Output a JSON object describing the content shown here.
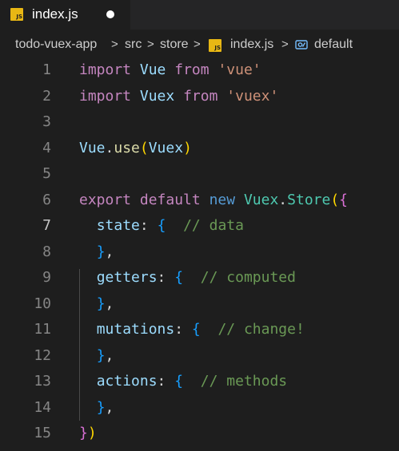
{
  "tab": {
    "label": "index.js",
    "icon": "js-file-icon",
    "badge_text": "JS",
    "dirty": true
  },
  "breadcrumb": {
    "items": [
      "todo-vuex-app",
      "src",
      "store",
      "index.js",
      "default"
    ],
    "separator": ">"
  },
  "editor": {
    "active_line": 7,
    "line_numbers": [
      "1",
      "2",
      "3",
      "4",
      "5",
      "6",
      "7",
      "8",
      "9",
      "10",
      "11",
      "12",
      "13",
      "14",
      "15"
    ],
    "lines": [
      [
        {
          "t": "import",
          "c": "kw-purple"
        },
        {
          "t": " "
        },
        {
          "t": "Vue",
          "c": "ident"
        },
        {
          "t": " "
        },
        {
          "t": "from",
          "c": "kw-purple"
        },
        {
          "t": " "
        },
        {
          "t": "'vue'",
          "c": "str"
        }
      ],
      [
        {
          "t": "import",
          "c": "kw-purple"
        },
        {
          "t": " "
        },
        {
          "t": "Vuex",
          "c": "ident"
        },
        {
          "t": " "
        },
        {
          "t": "from",
          "c": "kw-purple"
        },
        {
          "t": " "
        },
        {
          "t": "'vuex'",
          "c": "str"
        }
      ],
      [],
      [
        {
          "t": "Vue",
          "c": "ident"
        },
        {
          "t": "."
        },
        {
          "t": "use",
          "c": "fn"
        },
        {
          "t": "(",
          "c": "brk1"
        },
        {
          "t": "Vuex",
          "c": "ident"
        },
        {
          "t": ")",
          "c": "brk1"
        }
      ],
      [],
      [
        {
          "t": "export",
          "c": "kw-purple"
        },
        {
          "t": " "
        },
        {
          "t": "default",
          "c": "kw-purple"
        },
        {
          "t": " "
        },
        {
          "t": "new",
          "c": "kw-blue"
        },
        {
          "t": " "
        },
        {
          "t": "Vuex",
          "c": "cls"
        },
        {
          "t": "."
        },
        {
          "t": "Store",
          "c": "cls"
        },
        {
          "t": "(",
          "c": "brk1"
        },
        {
          "t": "{",
          "c": "brk2"
        }
      ],
      [
        {
          "t": "  "
        },
        {
          "t": "state",
          "c": "ident"
        },
        {
          "t": ": "
        },
        {
          "t": "{",
          "c": "brk3"
        },
        {
          "t": "  "
        },
        {
          "t": "// data",
          "c": "cmt"
        }
      ],
      [
        {
          "t": "  "
        },
        {
          "t": "}",
          "c": "brk3"
        },
        {
          "t": ","
        }
      ],
      [
        {
          "t": "  "
        },
        {
          "t": "getters",
          "c": "ident"
        },
        {
          "t": ": "
        },
        {
          "t": "{",
          "c": "brk3"
        },
        {
          "t": "  "
        },
        {
          "t": "// computed",
          "c": "cmt"
        }
      ],
      [
        {
          "t": "  "
        },
        {
          "t": "}",
          "c": "brk3"
        },
        {
          "t": ","
        }
      ],
      [
        {
          "t": "  "
        },
        {
          "t": "mutations",
          "c": "ident"
        },
        {
          "t": ": "
        },
        {
          "t": "{",
          "c": "brk3"
        },
        {
          "t": "  "
        },
        {
          "t": "// change!",
          "c": "cmt"
        }
      ],
      [
        {
          "t": "  "
        },
        {
          "t": "}",
          "c": "brk3"
        },
        {
          "t": ","
        }
      ],
      [
        {
          "t": "  "
        },
        {
          "t": "actions",
          "c": "ident"
        },
        {
          "t": ": "
        },
        {
          "t": "{",
          "c": "brk3"
        },
        {
          "t": "  "
        },
        {
          "t": "// methods",
          "c": "cmt"
        }
      ],
      [
        {
          "t": "  "
        },
        {
          "t": "}",
          "c": "brk3"
        },
        {
          "t": ","
        }
      ],
      [
        {
          "t": "}",
          "c": "brk2"
        },
        {
          "t": ")",
          "c": "brk1"
        }
      ]
    ]
  },
  "colors": {
    "background": "#1e1e1e",
    "tabbar": "#252526",
    "js_badge": "#e8b714",
    "keyword_purple": "#c586c0",
    "keyword_blue": "#569cd6",
    "identifier": "#9cdcfe",
    "class": "#4ec9b0",
    "function": "#dcdcaa",
    "string": "#ce9178",
    "comment": "#6a9955"
  }
}
